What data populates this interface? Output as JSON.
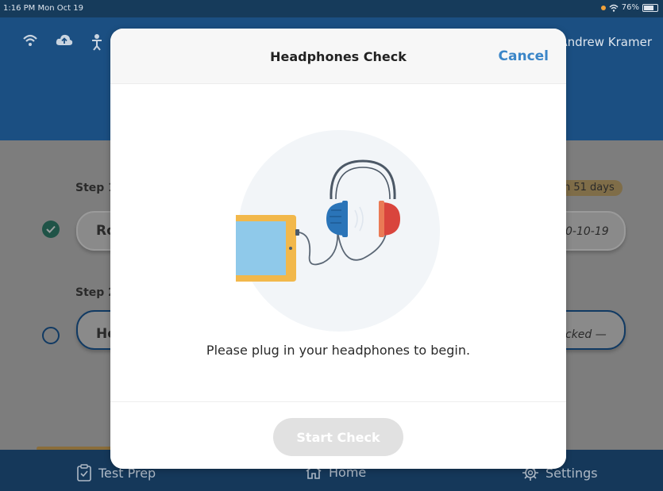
{
  "status_bar": {
    "time": "1:16 PM  Mon Oct 19",
    "battery": "76%"
  },
  "header": {
    "user_name": "Andrew Kramer",
    "icons": [
      "wifi-icon",
      "cloud-upload-icon",
      "person-icon"
    ]
  },
  "steps": [
    {
      "label": "Step 1",
      "item_text": "Ro",
      "right_text": "0-10-19",
      "badge": "n 51 days",
      "status": "checked"
    },
    {
      "label": "Step 2",
      "item_text": "He",
      "right_text": "cked —",
      "status": "unchecked"
    }
  ],
  "modal": {
    "title": "Headphones Check",
    "cancel_label": "Cancel",
    "message": "Please plug in your headphones to begin.",
    "start_button_label": "Start Check",
    "start_button_enabled": false
  },
  "tabs": [
    {
      "label": "Test Prep",
      "icon": "clipboard-icon"
    },
    {
      "label": "Home",
      "icon": "home-icon"
    },
    {
      "label": "Settings",
      "icon": "gear-icon"
    }
  ],
  "colors": {
    "header_blue": "#1b4f82",
    "accent_blue": "#3b86c8",
    "headphone_left": "#2a74b8",
    "headphone_right": "#d9453d",
    "tablet_frame": "#f2b84b"
  }
}
